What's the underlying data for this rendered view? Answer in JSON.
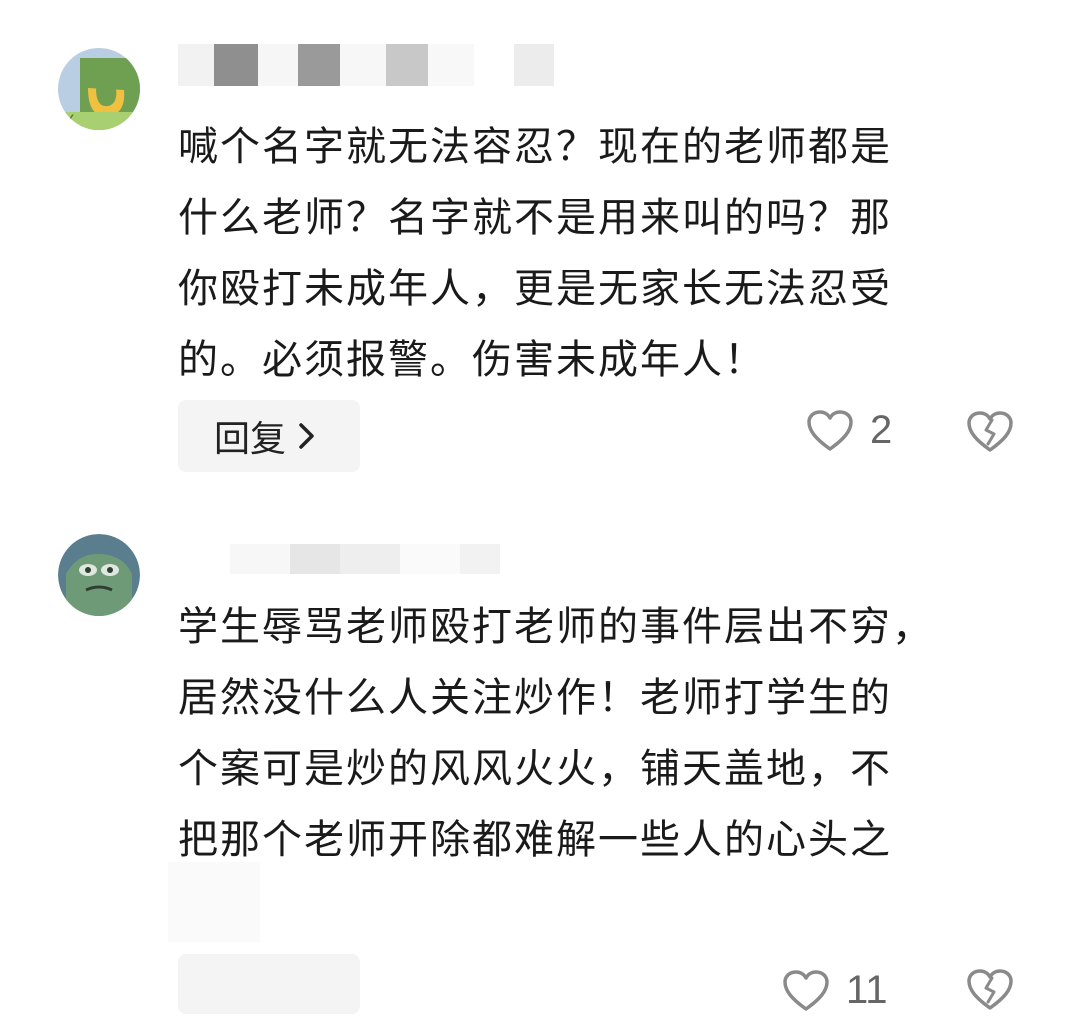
{
  "comments": [
    {
      "avatar": "frog-avatar-green",
      "lines": [
        "喊个名字就无法容忍？现在的老师都是",
        "什么老师？名字就不是用来叫的吗？那",
        "你殴打未成年人，更是无家长无法忍受",
        "的。必须报警。伤害未成年人！"
      ],
      "reply_label": "回复",
      "reply_icon": "chevron-right-icon",
      "like_icon": "heart-outline-icon",
      "like_count": "2",
      "dislike_icon": "broken-heart-icon"
    },
    {
      "avatar": "frog-avatar-blue",
      "lines": [
        "学生辱骂老师殴打老师的事件层出不穷，",
        "居然没什么人关注炒作！老师打学生的",
        "个案可是炒的风风火火，铺天盖地，不",
        "把那个老师开除都难解一些人的心头之"
      ],
      "like_icon": "heart-outline-icon",
      "like_count": "11",
      "dislike_icon": "broken-heart-icon"
    }
  ],
  "colors": {
    "reply_bg": "#f4f4f4",
    "icon_gray": "#8a8a8a",
    "text": "#1a1a1a"
  }
}
